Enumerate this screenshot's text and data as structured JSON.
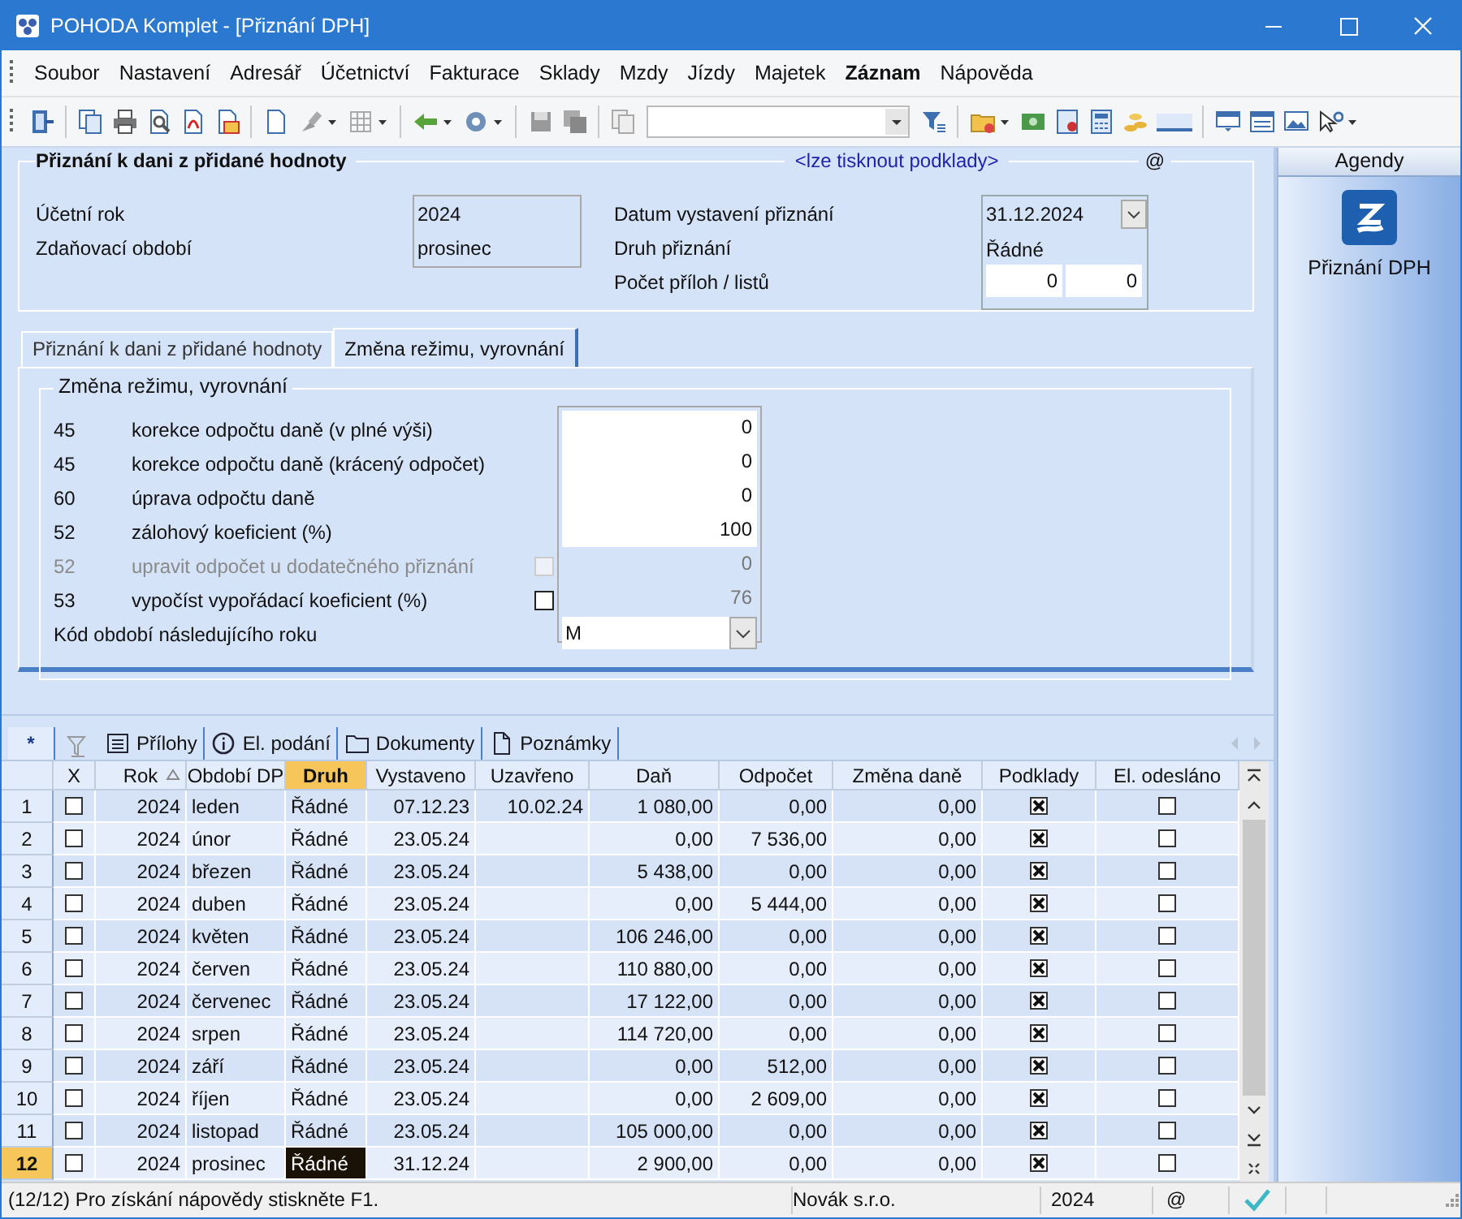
{
  "window": {
    "title": "POHODA Komplet - [Přiznání DPH]"
  },
  "menu": [
    {
      "label": "Soubor",
      "bold": false
    },
    {
      "label": "Nastavení",
      "bold": false
    },
    {
      "label": "Adresář",
      "bold": false
    },
    {
      "label": "Účetnictví",
      "bold": false
    },
    {
      "label": "Fakturace",
      "bold": false
    },
    {
      "label": "Sklady",
      "bold": false
    },
    {
      "label": "Mzdy",
      "bold": false
    },
    {
      "label": "Jízdy",
      "bold": false
    },
    {
      "label": "Majetek",
      "bold": false
    },
    {
      "label": "Záznam",
      "bold": true
    },
    {
      "label": "Nápověda",
      "bold": false
    }
  ],
  "header": {
    "title": "Přiznání k dani z přidané hodnoty",
    "link": "<lze tisknout podklady>",
    "at": "@",
    "fields_left": [
      {
        "label": "Účetní rok",
        "value": "2024"
      },
      {
        "label": "Zdaňovací období",
        "value": "prosinec"
      }
    ],
    "date": {
      "label": "Datum vystavení přiznání",
      "value": "31.12.2024"
    },
    "type": {
      "label": "Druh přiznání",
      "value": "Řádné"
    },
    "attachments": {
      "label": "Počet příloh / listů",
      "values": [
        "0",
        "0"
      ]
    }
  },
  "tabs": [
    {
      "label": "Přiznání k dani z přidané hodnoty",
      "selected": false
    },
    {
      "label": "Změna režimu, vyrovnání",
      "selected": true
    }
  ],
  "form": {
    "title": "Změna režimu, vyrovnání",
    "rows": [
      {
        "kind": "field",
        "code": "45",
        "label": "korekce odpočtu daně (v plné výši)",
        "value": "0",
        "disabled": false,
        "editable": true
      },
      {
        "kind": "field",
        "code": "45",
        "label": "korekce odpočtu daně (krácený odpočet)",
        "value": "0",
        "disabled": false,
        "editable": true
      },
      {
        "kind": "field",
        "code": "60",
        "label": "úprava odpočtu daně",
        "value": "0",
        "disabled": false,
        "editable": true
      },
      {
        "kind": "field",
        "code": "52",
        "label": "zálohový koeficient (%)",
        "value": "100",
        "disabled": false,
        "editable": true
      },
      {
        "kind": "checkbox-field",
        "code": "52",
        "label": "upravit odpočet u dodatečného přiznání",
        "checked": false,
        "value": "0",
        "disabled": true,
        "editable": false
      },
      {
        "kind": "checkbox-field",
        "code": "53",
        "label": "vypočíst vypořádací koeficient (%)",
        "checked": false,
        "value": "76",
        "disabled": false,
        "editable": false
      },
      {
        "kind": "select",
        "label": "Kód období následujícího roku",
        "value": "M"
      }
    ]
  },
  "grid_tabs": [
    {
      "kind": "text",
      "label": "*",
      "selected": true
    },
    {
      "kind": "filter"
    },
    {
      "kind": "list",
      "label": "Přílohy",
      "selected": false
    },
    {
      "kind": "info",
      "label": "El. podání",
      "selected": false
    },
    {
      "kind": "folder",
      "label": "Dokumenty",
      "selected": false
    },
    {
      "kind": "page",
      "label": "Poznámky",
      "selected": false
    }
  ],
  "table": {
    "columns": [
      {
        "label": "X",
        "kind": "check",
        "sorted": false,
        "selected": false
      },
      {
        "label": "Rok",
        "kind": "number",
        "sorted": true,
        "selected": false
      },
      {
        "label": "Období DP",
        "kind": "text",
        "sorted": false,
        "selected": false
      },
      {
        "label": "Druh",
        "kind": "text",
        "sorted": false,
        "selected": true
      },
      {
        "label": "Vystaveno",
        "kind": "number",
        "sorted": false,
        "selected": false
      },
      {
        "label": "Uzavřeno",
        "kind": "number",
        "sorted": false,
        "selected": false
      },
      {
        "label": "Daň",
        "kind": "number",
        "sorted": false,
        "selected": false
      },
      {
        "label": "Odpočet",
        "kind": "number",
        "sorted": false,
        "selected": false
      },
      {
        "label": "Změna daně",
        "kind": "number",
        "sorted": false,
        "selected": false
      },
      {
        "label": "Podklady",
        "kind": "check",
        "sorted": false,
        "selected": false
      },
      {
        "label": "El. odesláno",
        "kind": "check",
        "sorted": false,
        "selected": false
      }
    ],
    "rows": [
      {
        "number": "1",
        "current": false,
        "cells": [
          {
            "checked": false
          },
          "2024",
          "leden",
          "Řádné",
          "07.12.23",
          "10.02.24",
          "1 080,00",
          "0,00",
          "0,00",
          {
            "checked": true
          },
          {
            "checked": false
          }
        ]
      },
      {
        "number": "2",
        "current": false,
        "cells": [
          {
            "checked": false
          },
          "2024",
          "únor",
          "Řádné",
          "23.05.24",
          null,
          "0,00",
          "7 536,00",
          "0,00",
          {
            "checked": true
          },
          {
            "checked": false
          }
        ]
      },
      {
        "number": "3",
        "current": false,
        "cells": [
          {
            "checked": false
          },
          "2024",
          "březen",
          "Řádné",
          "23.05.24",
          null,
          "5 438,00",
          "0,00",
          "0,00",
          {
            "checked": true
          },
          {
            "checked": false
          }
        ]
      },
      {
        "number": "4",
        "current": false,
        "cells": [
          {
            "checked": false
          },
          "2024",
          "duben",
          "Řádné",
          "23.05.24",
          null,
          "0,00",
          "5 444,00",
          "0,00",
          {
            "checked": true
          },
          {
            "checked": false
          }
        ]
      },
      {
        "number": "5",
        "current": false,
        "cells": [
          {
            "checked": false
          },
          "2024",
          "květen",
          "Řádné",
          "23.05.24",
          null,
          "106 246,00",
          "0,00",
          "0,00",
          {
            "checked": true
          },
          {
            "checked": false
          }
        ]
      },
      {
        "number": "6",
        "current": false,
        "cells": [
          {
            "checked": false
          },
          "2024",
          "červen",
          "Řádné",
          "23.05.24",
          null,
          "110 880,00",
          "0,00",
          "0,00",
          {
            "checked": true
          },
          {
            "checked": false
          }
        ]
      },
      {
        "number": "7",
        "current": false,
        "cells": [
          {
            "checked": false
          },
          "2024",
          "červenec",
          "Řádné",
          "23.05.24",
          null,
          "17 122,00",
          "0,00",
          "0,00",
          {
            "checked": true
          },
          {
            "checked": false
          }
        ]
      },
      {
        "number": "8",
        "current": false,
        "cells": [
          {
            "checked": false
          },
          "2024",
          "srpen",
          "Řádné",
          "23.05.24",
          null,
          "114 720,00",
          "0,00",
          "0,00",
          {
            "checked": true
          },
          {
            "checked": false
          }
        ]
      },
      {
        "number": "9",
        "current": false,
        "cells": [
          {
            "checked": false
          },
          "2024",
          "září",
          "Řádné",
          "23.05.24",
          null,
          "0,00",
          "512,00",
          "0,00",
          {
            "checked": true
          },
          {
            "checked": false
          }
        ]
      },
      {
        "number": "10",
        "current": false,
        "cells": [
          {
            "checked": false
          },
          "2024",
          "říjen",
          "Řádné",
          "23.05.24",
          null,
          "0,00",
          "2 609,00",
          "0,00",
          {
            "checked": true
          },
          {
            "checked": false
          }
        ]
      },
      {
        "number": "11",
        "current": false,
        "cells": [
          {
            "checked": false
          },
          "2024",
          "listopad",
          "Řádné",
          "23.05.24",
          null,
          "105 000,00",
          "0,00",
          "0,00",
          {
            "checked": true
          },
          {
            "checked": false
          }
        ]
      },
      {
        "number": "12",
        "current": true,
        "cells": [
          {
            "checked": false
          },
          "2024",
          "prosinec",
          "Řádné",
          "31.12.24",
          null,
          "2 900,00",
          "0,00",
          "0,00",
          {
            "checked": true
          },
          {
            "checked": false
          }
        ]
      }
    ]
  },
  "status_bar": {
    "message": "(12/12) Pro získání nápovědy stiskněte F1.",
    "company": "Novák s.r.o.",
    "year": "2024",
    "at": "@"
  },
  "sidebar": {
    "title": "Agendy",
    "items": [
      {
        "label": "Přiznání DPH"
      }
    ]
  }
}
